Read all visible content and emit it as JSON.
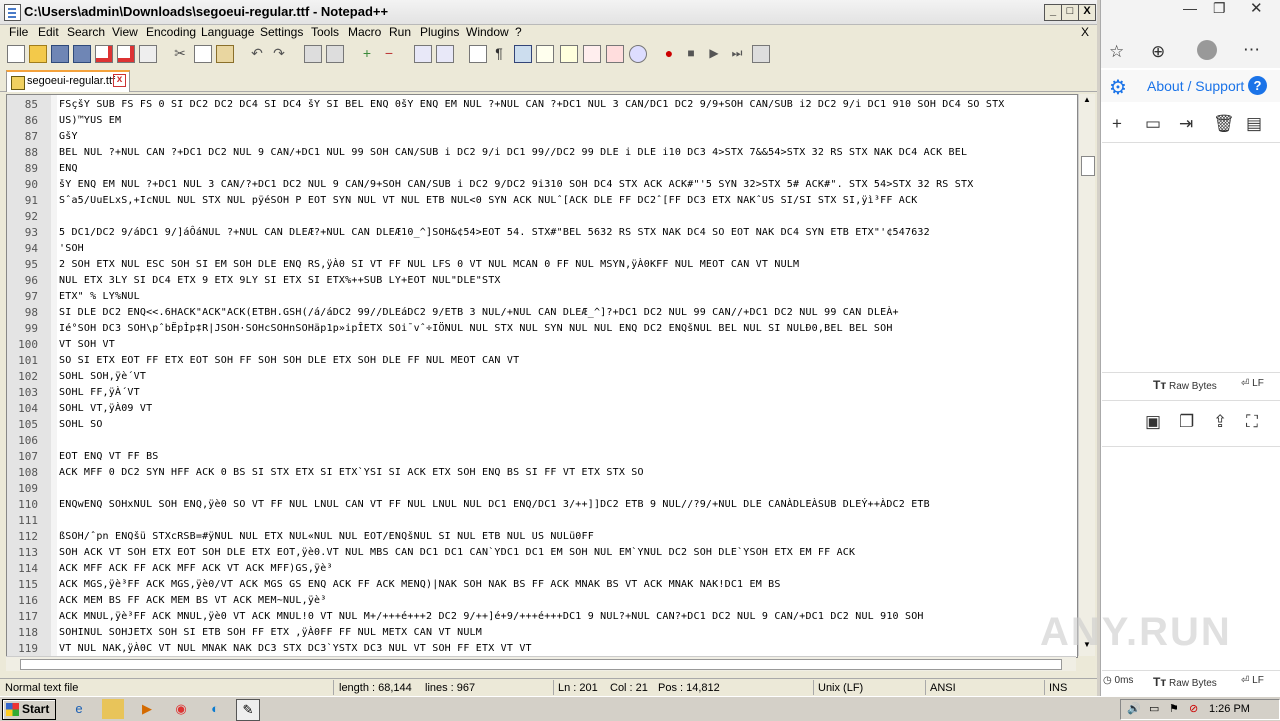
{
  "window": {
    "title": "C:\\Users\\admin\\Downloads\\segoeui-regular.ttf - Notepad++",
    "min_label": "_",
    "max_label": "□",
    "close_label": "X"
  },
  "menu": [
    "File",
    "Edit",
    "Search",
    "View",
    "Encoding",
    "Language",
    "Settings",
    "Tools",
    "Macro",
    "Run",
    "Plugins",
    "Window",
    "?"
  ],
  "menu_close": "X",
  "tab": {
    "label": "segoeui-regular.ttf",
    "close": "x"
  },
  "editor": {
    "lines": [
      {
        "n": "85",
        "t": "FSçšY SUB FS FS 0 SI DC2 DC2 DC4 SI DC4 šY SI BEL ENQ 0šY ENQ EM NUL ?+NUL CAN ?+DC1 NUL 3 CAN/DC1 DC2 9/9+SOH CAN/SUB i2 DC2 9/i DC1 910 SOH DC4 SO STX"
      },
      {
        "n": "86",
        "t": "US)™YUS EM"
      },
      {
        "n": "87",
        "t": "GšY"
      },
      {
        "n": "88",
        "t": "BEL NUL ?+NUL CAN ?+DC1 DC2 NUL 9 CAN/+DC1 NUL 99 SOH CAN/SUB i DC2 9/i DC1 99//DC2 99 DLE i DLE i10 DC3 4>STX 7&&54>STX 32 RS STX NAK DC4 ACK BEL"
      },
      {
        "n": "89",
        "t": "ENQ"
      },
      {
        "n": "90",
        "t": "šY ENQ EM NUL ?+DC1 NUL 3 CAN/?+DC1 DC2 NUL 9 CAN/9+SOH CAN/SUB i DC2 9/DC2 9i310 SOH DC4 STX ACK ACK#\"'5 SYN 32>STX 5# ACK#\". STX 54>STX 32 RS STX"
      },
      {
        "n": "91",
        "t": "Sˆa5/UuELxS,+IcNUL NUL STX NUL pÿéSOH P EOT SYN NUL VT NUL ETB NUL<0 SYN ACK NULˆ[ACK DLE FF DC2ˆ[FF DC3   ETX NAKˆUS SI/SI STX SI,ÿì³FF ACK"
      },
      {
        "n": "92",
        "t": ""
      },
      {
        "n": "93",
        "t": "5 DC1/DC2 9/áDC1 9/]áÔáNUL ?+NUL CAN DLEÆ?+NUL CAN DLEÆ10_^]SOH&¢54>EOT 54. STX#\"BEL 5632 RS STX NAK DC4 SO EOT NAK DC4 SYN ETB ETX\"'¢547632"
      },
      {
        "n": "94",
        "t": "'SOH"
      },
      {
        "n": "95",
        "t": "2 SOH ETX NUL ESC SOH SI EM SOH DLE ENQ RS,ÿÀ0 SI VT FF NUL LFS 0 VT NUL MCAN 0 FF NUL MSYN,ÿÀ0KFF NUL MEOT CAN VT NULM"
      },
      {
        "n": "96",
        "t": "NUL ETX     3LY  SI DC4 ETX 9 ETX 9LY SI ETX SI ETX%++SUB LY+EOT NUL\"DLE\"STX"
      },
      {
        "n": "97",
        "t": "ETX\" % LY%NUL"
      },
      {
        "n": "98",
        "t": "SI DLE DC2 ENQ<<.6HACK\"ACK\"ACK(ETBH.GSH(/á/áDC2 99//DLEáDC2 9/ETB 3 NUL/+NUL CAN DLEÆ_^]?+DC1 DC2 NUL 99 CAN//+DC1 DC2 NUL 99 CAN DLEÀ+"
      },
      {
        "n": "99",
        "t": "Ié°SOH DC3 SOH\\pˆbËpÌp‡R|JSOH·SOHcSOHnSOHäp1p»ipÎETX SOi¯vˆ÷IÖNUL NUL STX NUL SYN NUL NUL ENQ DC2 ENQšNUL BEL NUL SI NULÐ0,BEL BEL SOH"
      },
      {
        "n": "100",
        "t": "VT SOH VT"
      },
      {
        "n": "101",
        "t": "SO SI ETX EOT FF ETX EOT SOH FF SOH SOH DLE ETX SOH DLE FF NUL MEOT CAN VT"
      },
      {
        "n": "102",
        "t": "SOHL SOH,ÿè´VT"
      },
      {
        "n": "103",
        "t": "SOHL FF,ÿÀ´VT"
      },
      {
        "n": "104",
        "t": "SOHL VT,ÿÀ09 VT"
      },
      {
        "n": "105",
        "t": "SOHL SO"
      },
      {
        "n": "106",
        "t": ""
      },
      {
        "n": "107",
        "t": "EOT ENQ VT FF BS"
      },
      {
        "n": "108",
        "t": "ACK MFF 0 DC2 SYN HFF ACK 0 BS SI STX ETX SI ETX`YSI SI ACK ETX SOH ENQ BS SI FF VT ETX STX SO"
      },
      {
        "n": "109",
        "t": ""
      },
      {
        "n": "110",
        "t": "ENQwENQ SOHxNUL SOH ENQ,ÿè0 SO VT FF NUL LNUL CAN VT FF NUL LNUL NUL DC1 ENQ/DC1 3/++]]DC2 ETB 9 NUL//?9/+NUL DLE CANÀDLEÀSUB DLEÝ++ÀDC2 ETB"
      },
      {
        "n": "111",
        "t": ""
      },
      {
        "n": "112",
        "t": "ßSOH/ˆpn ENQšü STXcRSB=#ÿNUL NUL ETX NUL«NUL NUL EOT/ENQšNUL SI NUL ETB NUL US NULü0FF"
      },
      {
        "n": "113",
        "t": "SOH ACK VT SOH ETX EOT SOH DLE ETX EOT,ÿè0.VT NUL MBS CAN DC1 DC1 CAN`YDC1 DC1 EM SOH NUL EM`YNUL DC2 SOH DLE`YSOH ETX    EM FF ACK"
      },
      {
        "n": "114",
        "t": "ACK MFF ACK FF ACK MFF ACK VT ACK MFF)GS,ÿè³"
      },
      {
        "n": "115",
        "t": "ACK MGS,ÿè³FF ACK MGS,ÿè0/VT ACK MGS GS ENQ ACK FF ACK MENQ)|NAK SOH NAK BS FF ACK MNAK BS VT ACK MNAK NAK!DC1 EM BS"
      },
      {
        "n": "116",
        "t": "ACK MEM BS FF ACK MEM BS VT ACK MEM~NUL,ÿè³"
      },
      {
        "n": "117",
        "t": "ACK MNUL,ÿè³FF ACK MNUL,ÿè0   VT ACK MNUL!0 VT NUL M+/+++é+++2 DC2 9/++]é+9/+++é+++DC1 9 NUL?+NUL CAN?+DC1 DC2 NUL 9 CAN/+DC1 DC2 NUL 910 SOH"
      },
      {
        "n": "118",
        "t": "SOHINUL SOHJETX SOH SI ETB SOH FF ETX    ,ÿÀ0FF FF NUL METX CAN VT NULM"
      },
      {
        "n": "119",
        "t": "VT NUL NAK,ÿÀ0C VT NUL MNAK NAK DC3 STX DC3`YSTX DC3 NUL VT SOH FF ETX VT VT"
      }
    ]
  },
  "status": {
    "filetype": "Normal text file",
    "length": "length : 68,144",
    "lines": "lines : 967",
    "ln": "Ln : 201",
    "col": "Col : 21",
    "pos": "Pos : 14,812",
    "eol": "Unix (LF)",
    "encoding": "ANSI",
    "mode": "INS"
  },
  "right_panel": {
    "about_label": "About / Support",
    "help_label": "?",
    "raw_bytes_1": "Raw Bytes",
    "lf_1": "LF",
    "ms_label": "0ms",
    "raw_bytes_2": "Raw Bytes",
    "lf_2": "LF"
  },
  "taskbar": {
    "start_label": "Start",
    "clock": "1:26 PM"
  },
  "watermark": "ANY.RUN"
}
